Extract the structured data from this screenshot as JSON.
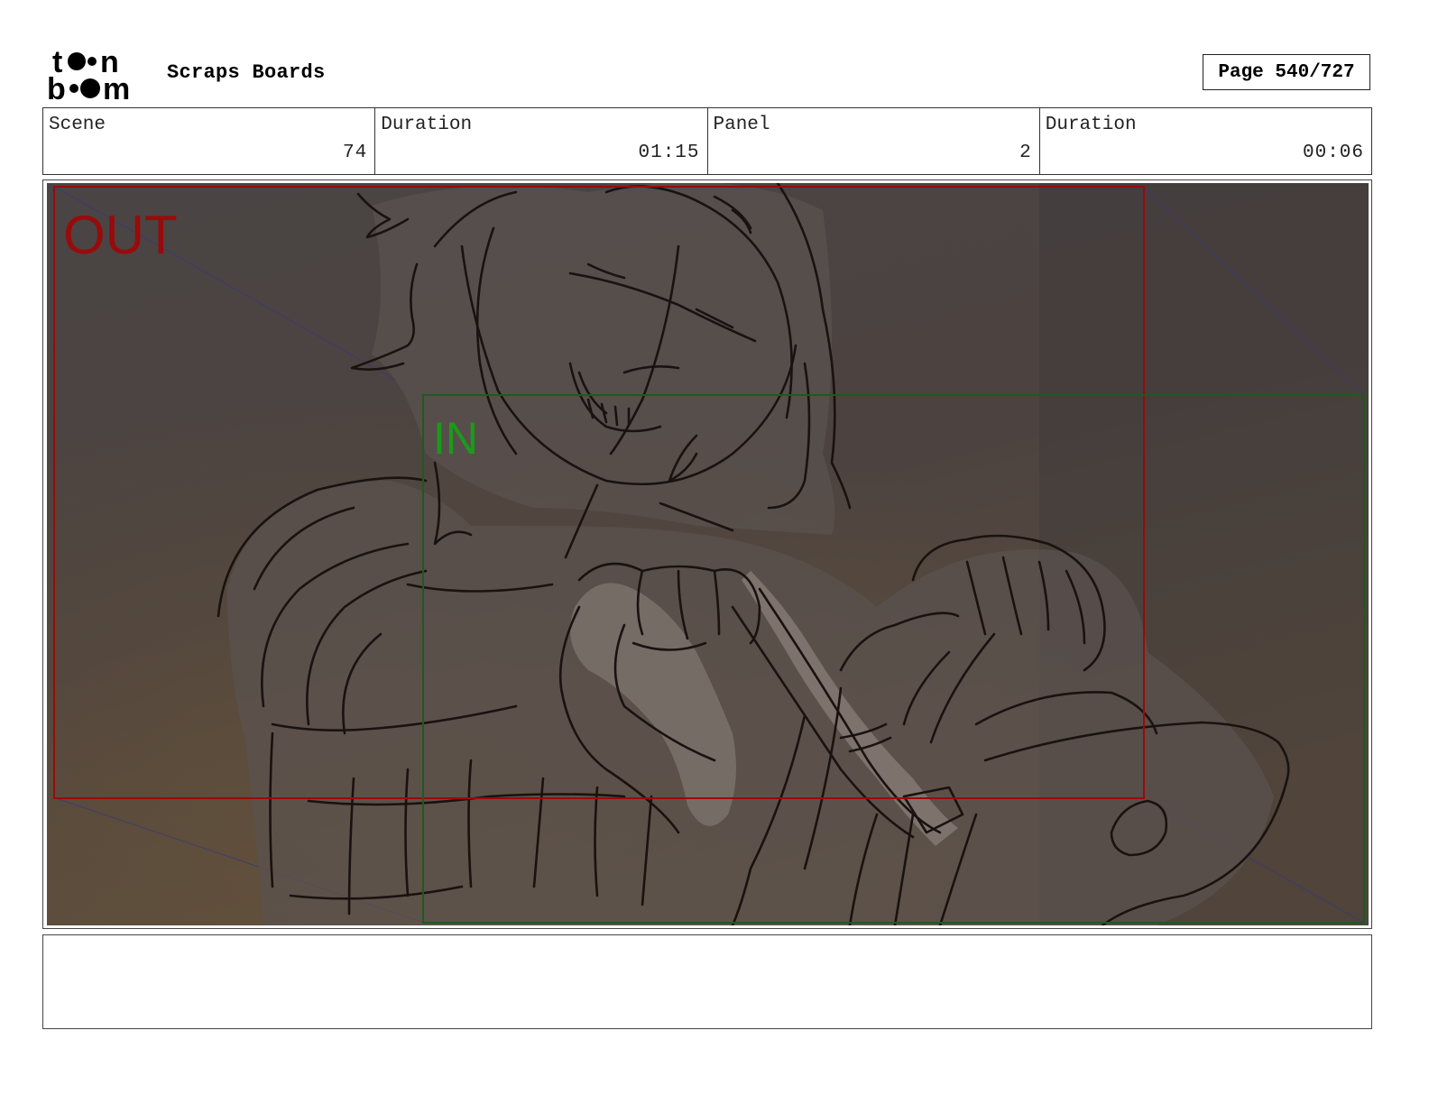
{
  "header": {
    "logo_label": "toon boom",
    "project_title": "Scraps Boards",
    "page_label": "Page 540/727"
  },
  "info": [
    {
      "label": "Scene",
      "value": "74"
    },
    {
      "label": "Duration",
      "value": "01:15"
    },
    {
      "label": "Panel",
      "value": "2"
    },
    {
      "label": "Duration",
      "value": "00:06"
    }
  ],
  "panel": {
    "out_label": "OUT",
    "in_label": "IN",
    "out_color": "#9a0a0a",
    "in_color": "#1b9a1b",
    "description": ""
  },
  "notes": {
    "text": ""
  }
}
